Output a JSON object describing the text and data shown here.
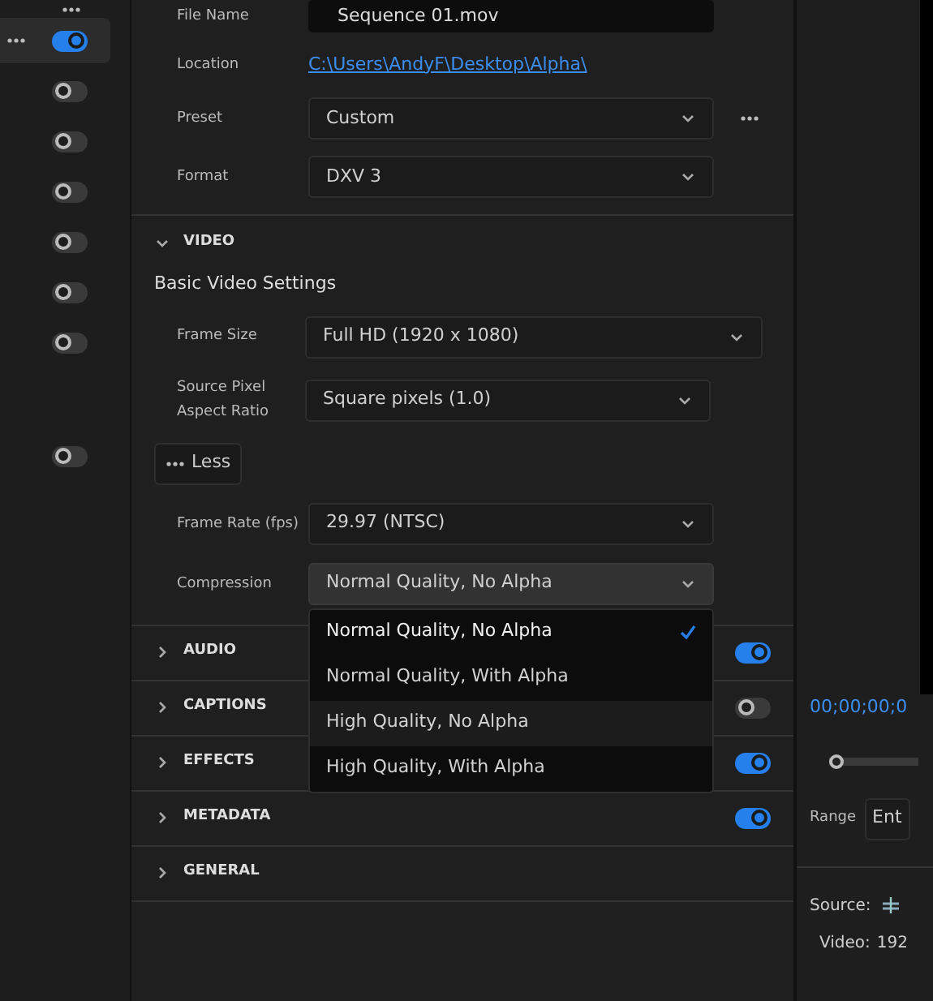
{
  "sidebar": {
    "items": [
      {
        "kind": "menu"
      },
      {
        "kind": "toggle",
        "menu": true,
        "selected": true,
        "on": true
      },
      {
        "kind": "toggle",
        "menu": false,
        "selected": false,
        "on": false
      },
      {
        "kind": "toggle",
        "menu": false,
        "selected": false,
        "on": false
      },
      {
        "kind": "toggle",
        "menu": false,
        "selected": false,
        "on": false
      },
      {
        "kind": "toggle",
        "menu": false,
        "selected": false,
        "on": false
      },
      {
        "kind": "toggle",
        "menu": false,
        "selected": false,
        "on": false
      },
      {
        "kind": "toggle",
        "menu": false,
        "selected": false,
        "on": false
      }
    ],
    "lower_items": [
      {
        "kind": "toggle",
        "menu": false,
        "selected": false,
        "on": false
      }
    ]
  },
  "file_name": {
    "label": "File Name",
    "value": "Sequence 01.mov"
  },
  "location": {
    "label": "Location",
    "value": "C:\\Users\\AndyF\\Desktop\\Alpha\\"
  },
  "preset": {
    "label": "Preset",
    "value": "Custom"
  },
  "format": {
    "label": "Format",
    "value": "DXV 3"
  },
  "video": {
    "title": "VIDEO",
    "expanded": true,
    "heading": "Basic Video Settings",
    "fields": [
      {
        "label": "Frame Size",
        "value": "Full HD (1920 x 1080)",
        "wide": true
      },
      {
        "label": "Source Pixel Aspect Ratio",
        "value": "Square pixels (1.0)",
        "wide": false
      }
    ],
    "less_button": "Less",
    "more_fields": [
      {
        "label": "Frame Rate (fps)",
        "value": "29.97 (NTSC)"
      },
      {
        "label": "Compression",
        "value": "Normal Quality, No Alpha",
        "open": true
      }
    ]
  },
  "compression_menu": [
    {
      "label": "Normal Quality, No Alpha",
      "selected": true,
      "hovered": false
    },
    {
      "label": "Normal Quality, With Alpha",
      "selected": false,
      "hovered": false
    },
    {
      "label": "High Quality, No Alpha",
      "selected": false,
      "hovered": true
    },
    {
      "label": "High Quality, With Alpha",
      "selected": false,
      "hovered": false
    }
  ],
  "sections": [
    {
      "title": "AUDIO",
      "expanded": false,
      "on": true
    },
    {
      "title": "CAPTIONS",
      "expanded": false,
      "on": false
    },
    {
      "title": "EFFECTS",
      "expanded": false,
      "on": true
    },
    {
      "title": "METADATA",
      "expanded": false,
      "on": true
    },
    {
      "title": "GENERAL",
      "expanded": false
    }
  ],
  "preview": {
    "timecode": "00;00;00;0",
    "playhead": {
      "level": 0
    },
    "range_label": "Range",
    "range_value": "Ent",
    "source_label": "Source:",
    "video_label": "Video:",
    "video_value": "192"
  }
}
